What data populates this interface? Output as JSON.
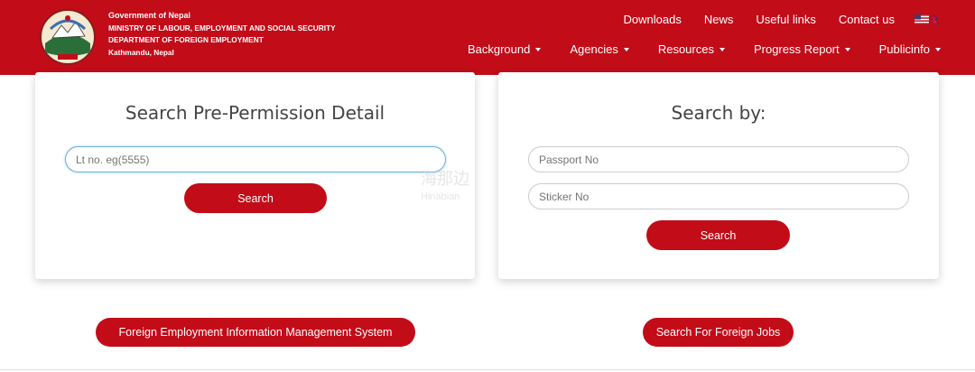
{
  "header": {
    "org_lines": [
      "Government of Nepal",
      "MINISTRY OF LABOUR, EMPLOYMENT AND SOCIAL SECURITY",
      "DEPARTMENT OF FOREIGN EMPLOYMENT",
      "Kathmandu, Nepal"
    ],
    "top_links": [
      "Downloads",
      "News",
      "Useful links",
      "Contact us"
    ],
    "main_nav": [
      "Background",
      "Agencies",
      "Resources",
      "Progress Report",
      "Publicinfo"
    ],
    "brand_color": "#c20c18"
  },
  "left_card": {
    "title": "Search Pre-Permission Detail",
    "input_placeholder": "Lt no. eg(5555)",
    "button_label": "Search"
  },
  "right_card": {
    "title": "Search by:",
    "passport_placeholder": "Passport No",
    "sticker_placeholder": "Sticker No",
    "button_label": "Search"
  },
  "watermark": {
    "line1": "海那边",
    "line2": "Hinabian"
  },
  "bottom": {
    "feims_label": "Foreign Employment Information Management System",
    "jobs_label": "Search For Foreign Jobs"
  }
}
